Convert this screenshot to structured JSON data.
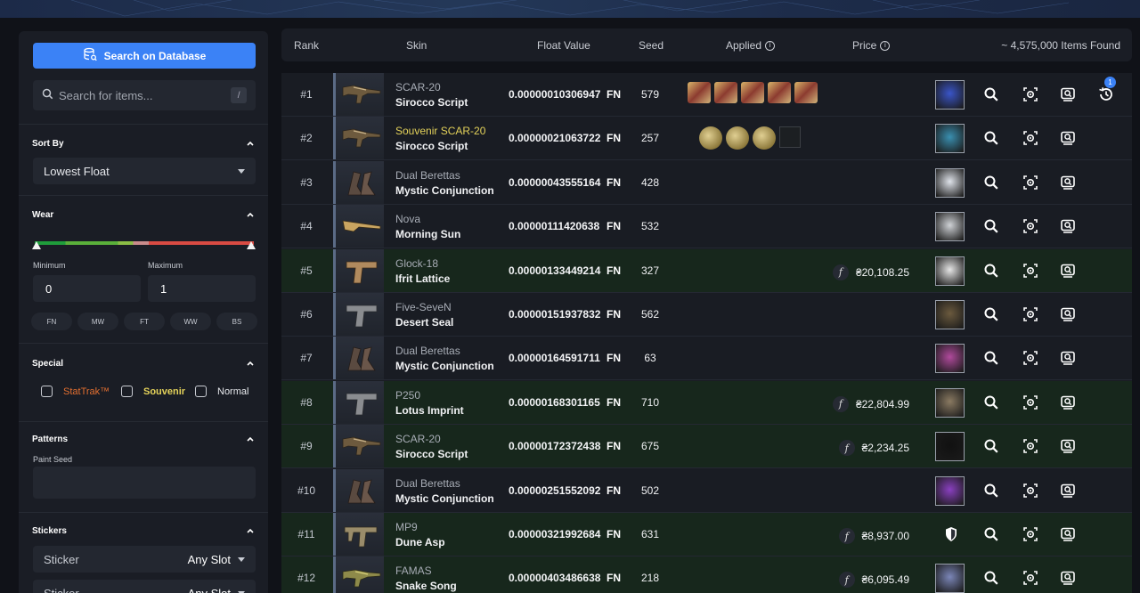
{
  "sidebar": {
    "db_button": "Search on Database",
    "search_placeholder": "Search for items...",
    "search_kbd": "/",
    "sort_title": "Sort By",
    "sort_value": "Lowest Float",
    "wear_title": "Wear",
    "min_label": "Minimum",
    "max_label": "Maximum",
    "min_value": "0",
    "max_value": "1",
    "wear_pills": [
      "FN",
      "MW",
      "FT",
      "WW",
      "BS"
    ],
    "special_title": "Special",
    "special_options": [
      "StatTrak™",
      "Souvenir",
      "Normal"
    ],
    "patterns_title": "Patterns",
    "paint_seed_label": "Paint Seed",
    "stickers_title": "Stickers",
    "sticker_label": "Sticker",
    "sticker_slot": "Any Slot",
    "colors": {
      "stattrak": "#e36f30",
      "souvenir": "#e4d25a",
      "accent": "#3b82f6"
    }
  },
  "table": {
    "headers": {
      "rank": "Rank",
      "skin": "Skin",
      "float": "Float Value",
      "seed": "Seed",
      "applied": "Applied",
      "price": "Price",
      "found": "~ 4,575,000 Items Found"
    },
    "history_badge": "1",
    "rows": [
      {
        "rank": "#1",
        "weapon": "SCAR-20",
        "skin": "Sirocco Script",
        "float": "0.00000010306947",
        "wear": "FN",
        "seed": "579",
        "price": "",
        "stickers": "tag5",
        "green": false,
        "souvenir": false,
        "gun": "rifle",
        "avatar": "#3a55c8"
      },
      {
        "rank": "#2",
        "weapon": "Souvenir SCAR-20",
        "skin": "Sirocco Script",
        "float": "0.00000021063722",
        "wear": "FN",
        "seed": "257",
        "price": "",
        "stickers": "coin",
        "green": false,
        "souvenir": true,
        "gun": "rifle",
        "avatar": "#3a8fb0"
      },
      {
        "rank": "#3",
        "weapon": "Dual Berettas",
        "skin": "Mystic Conjunction",
        "float": "0.00000043555164",
        "wear": "FN",
        "seed": "428",
        "price": "",
        "stickers": "",
        "green": false,
        "souvenir": false,
        "gun": "dual",
        "avatar": "#dfe3ea"
      },
      {
        "rank": "#4",
        "weapon": "Nova",
        "skin": "Morning Sun",
        "float": "0.00000111420638",
        "wear": "FN",
        "seed": "532",
        "price": "",
        "stickers": "",
        "green": false,
        "souvenir": false,
        "gun": "shotgun",
        "avatar": "#cfd2d6"
      },
      {
        "rank": "#5",
        "weapon": "Glock-18",
        "skin": "Ifrit Lattice",
        "float": "0.00000133449214",
        "wear": "FN",
        "seed": "327",
        "price": "₴20,108.25",
        "stickers": "",
        "green": true,
        "souvenir": false,
        "gun": "pistol",
        "avatar": "#e6e6e6"
      },
      {
        "rank": "#6",
        "weapon": "Five-SeveN",
        "skin": "Desert Seal",
        "float": "0.00000151937832",
        "wear": "FN",
        "seed": "562",
        "price": "",
        "stickers": "",
        "green": false,
        "souvenir": false,
        "gun": "pistol2",
        "avatar": "#6b5a3e"
      },
      {
        "rank": "#7",
        "weapon": "Dual Berettas",
        "skin": "Mystic Conjunction",
        "float": "0.00000164591711",
        "wear": "FN",
        "seed": "63",
        "price": "",
        "stickers": "",
        "green": false,
        "souvenir": false,
        "gun": "dual",
        "avatar": "#b04a9c"
      },
      {
        "rank": "#8",
        "weapon": "P250",
        "skin": "Lotus Imprint",
        "float": "0.00000168301165",
        "wear": "FN",
        "seed": "710",
        "price": "₴22,804.99",
        "stickers": "",
        "green": true,
        "souvenir": false,
        "gun": "pistol2",
        "avatar": "#8a7a62"
      },
      {
        "rank": "#9",
        "weapon": "SCAR-20",
        "skin": "Sirocco Script",
        "float": "0.00000172372438",
        "wear": "FN",
        "seed": "675",
        "price": "₴2,234.25",
        "stickers": "",
        "green": true,
        "souvenir": false,
        "gun": "rifle",
        "avatar": "#111111"
      },
      {
        "rank": "#10",
        "weapon": "Dual Berettas",
        "skin": "Mystic Conjunction",
        "float": "0.00000251552092",
        "wear": "FN",
        "seed": "502",
        "price": "",
        "stickers": "",
        "green": false,
        "souvenir": false,
        "gun": "dual",
        "avatar": "#8a40c0"
      },
      {
        "rank": "#11",
        "weapon": "MP9",
        "skin": "Dune Asp",
        "float": "0.00000321992684",
        "wear": "FN",
        "seed": "631",
        "price": "₴8,937.00",
        "stickers": "",
        "green": true,
        "souvenir": false,
        "gun": "smg",
        "avatar": "shield"
      },
      {
        "rank": "#12",
        "weapon": "FAMAS",
        "skin": "Snake Song",
        "float": "0.00000403486638",
        "wear": "FN",
        "seed": "218",
        "price": "₴6,095.49",
        "stickers": "",
        "green": true,
        "souvenir": false,
        "gun": "rifle2",
        "avatar": "#7b86b8"
      }
    ]
  }
}
